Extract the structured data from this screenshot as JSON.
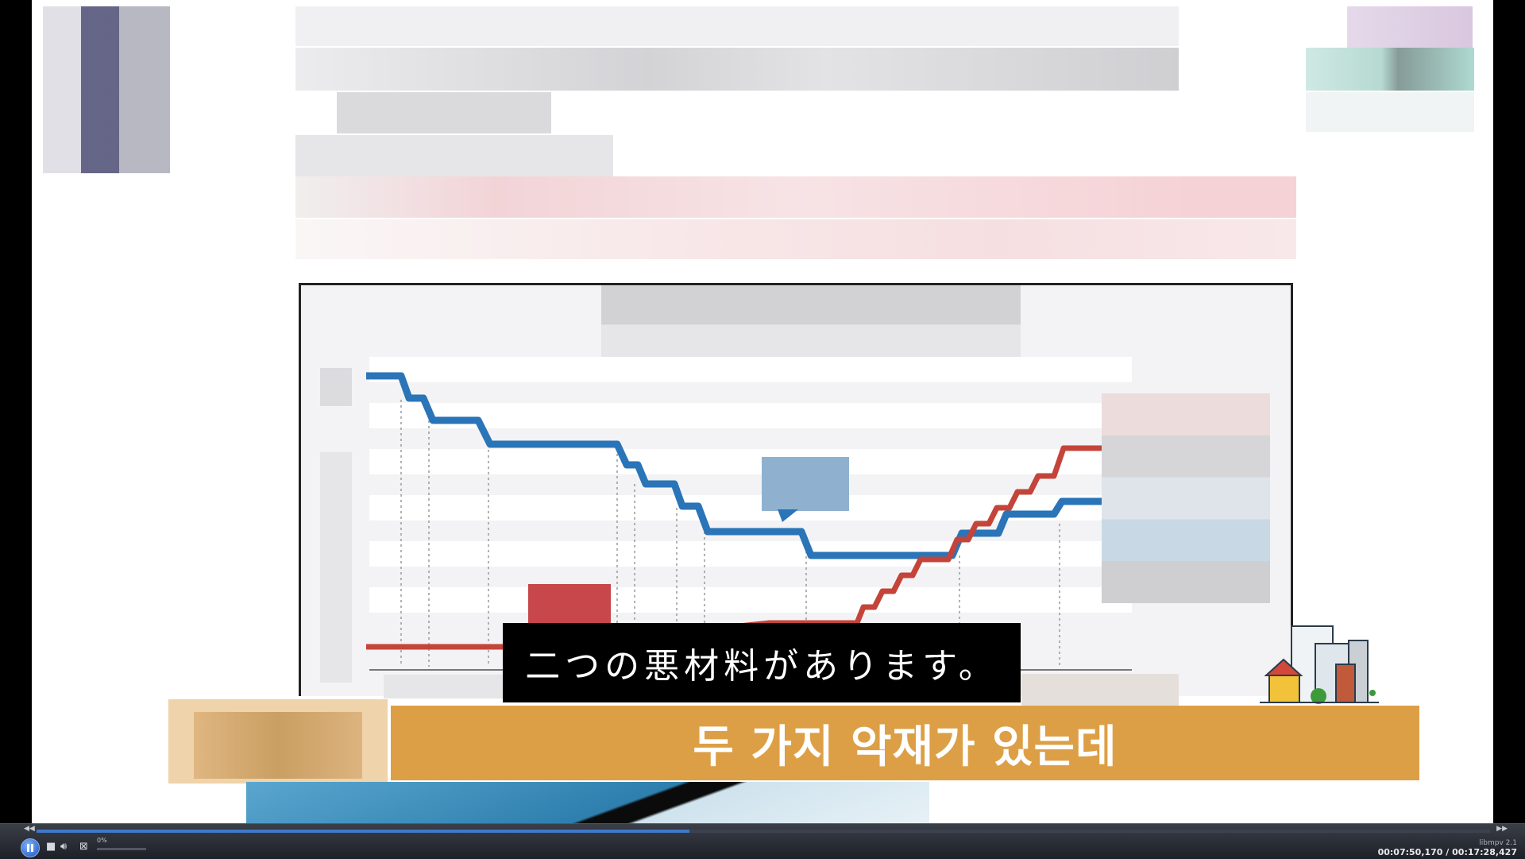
{
  "subtitle": {
    "text": "二つの悪材料があります。"
  },
  "banner": {
    "text": "두 가지 악재가 있는데"
  },
  "player": {
    "volume_label": "0%",
    "app_name": "libmpv 2.1",
    "timecode": "00:07:50,170 / 00:17:28,427",
    "progress_fraction": 0.449
  },
  "chart": {
    "line_colors": {
      "blue": "#2a74b8",
      "red": "#c4443a"
    }
  }
}
